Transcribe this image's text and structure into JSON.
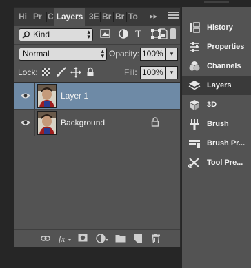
{
  "layers_panel": {
    "tabs": [
      {
        "label": "Hi",
        "active": false
      },
      {
        "label": "Pr",
        "active": false
      },
      {
        "label": "Ch",
        "active": false
      },
      {
        "label": "Layers",
        "active": true
      },
      {
        "label": "3E",
        "active": false
      },
      {
        "label": "Br",
        "active": false
      },
      {
        "label": "Br",
        "active": false
      },
      {
        "label": "To",
        "active": false
      }
    ],
    "overflow_glyph": "▸▸",
    "filter": {
      "kind_label": "Kind"
    },
    "blend": {
      "mode": "Normal",
      "opacity_label": "Opacity:",
      "opacity_value": "100%"
    },
    "lock": {
      "label": "Lock:",
      "fill_label": "Fill:",
      "fill_value": "100%"
    },
    "layers": [
      {
        "name": "Layer 1",
        "selected": true,
        "visible": true,
        "locked": false
      },
      {
        "name": "Background",
        "selected": false,
        "visible": true,
        "locked": true
      }
    ]
  },
  "dock": {
    "items": [
      {
        "label": "History",
        "icon": "history-icon",
        "active": false
      },
      {
        "label": "Properties",
        "icon": "properties-icon",
        "active": false
      },
      {
        "label": "Channels",
        "icon": "channels-icon",
        "active": false
      },
      {
        "label": "Layers",
        "icon": "layers-icon",
        "active": true
      },
      {
        "label": "3D",
        "icon": "cube-icon",
        "active": false
      },
      {
        "label": "Brush",
        "icon": "brush-icon",
        "active": false
      },
      {
        "label": "Brush Pr...",
        "icon": "brush-presets-icon",
        "active": false
      },
      {
        "label": "Tool Pre...",
        "icon": "tool-presets-icon",
        "active": false
      }
    ]
  },
  "colors": {
    "panel_bg": "#535353",
    "selected_row": "#6e8aa6",
    "background": "#262626"
  }
}
